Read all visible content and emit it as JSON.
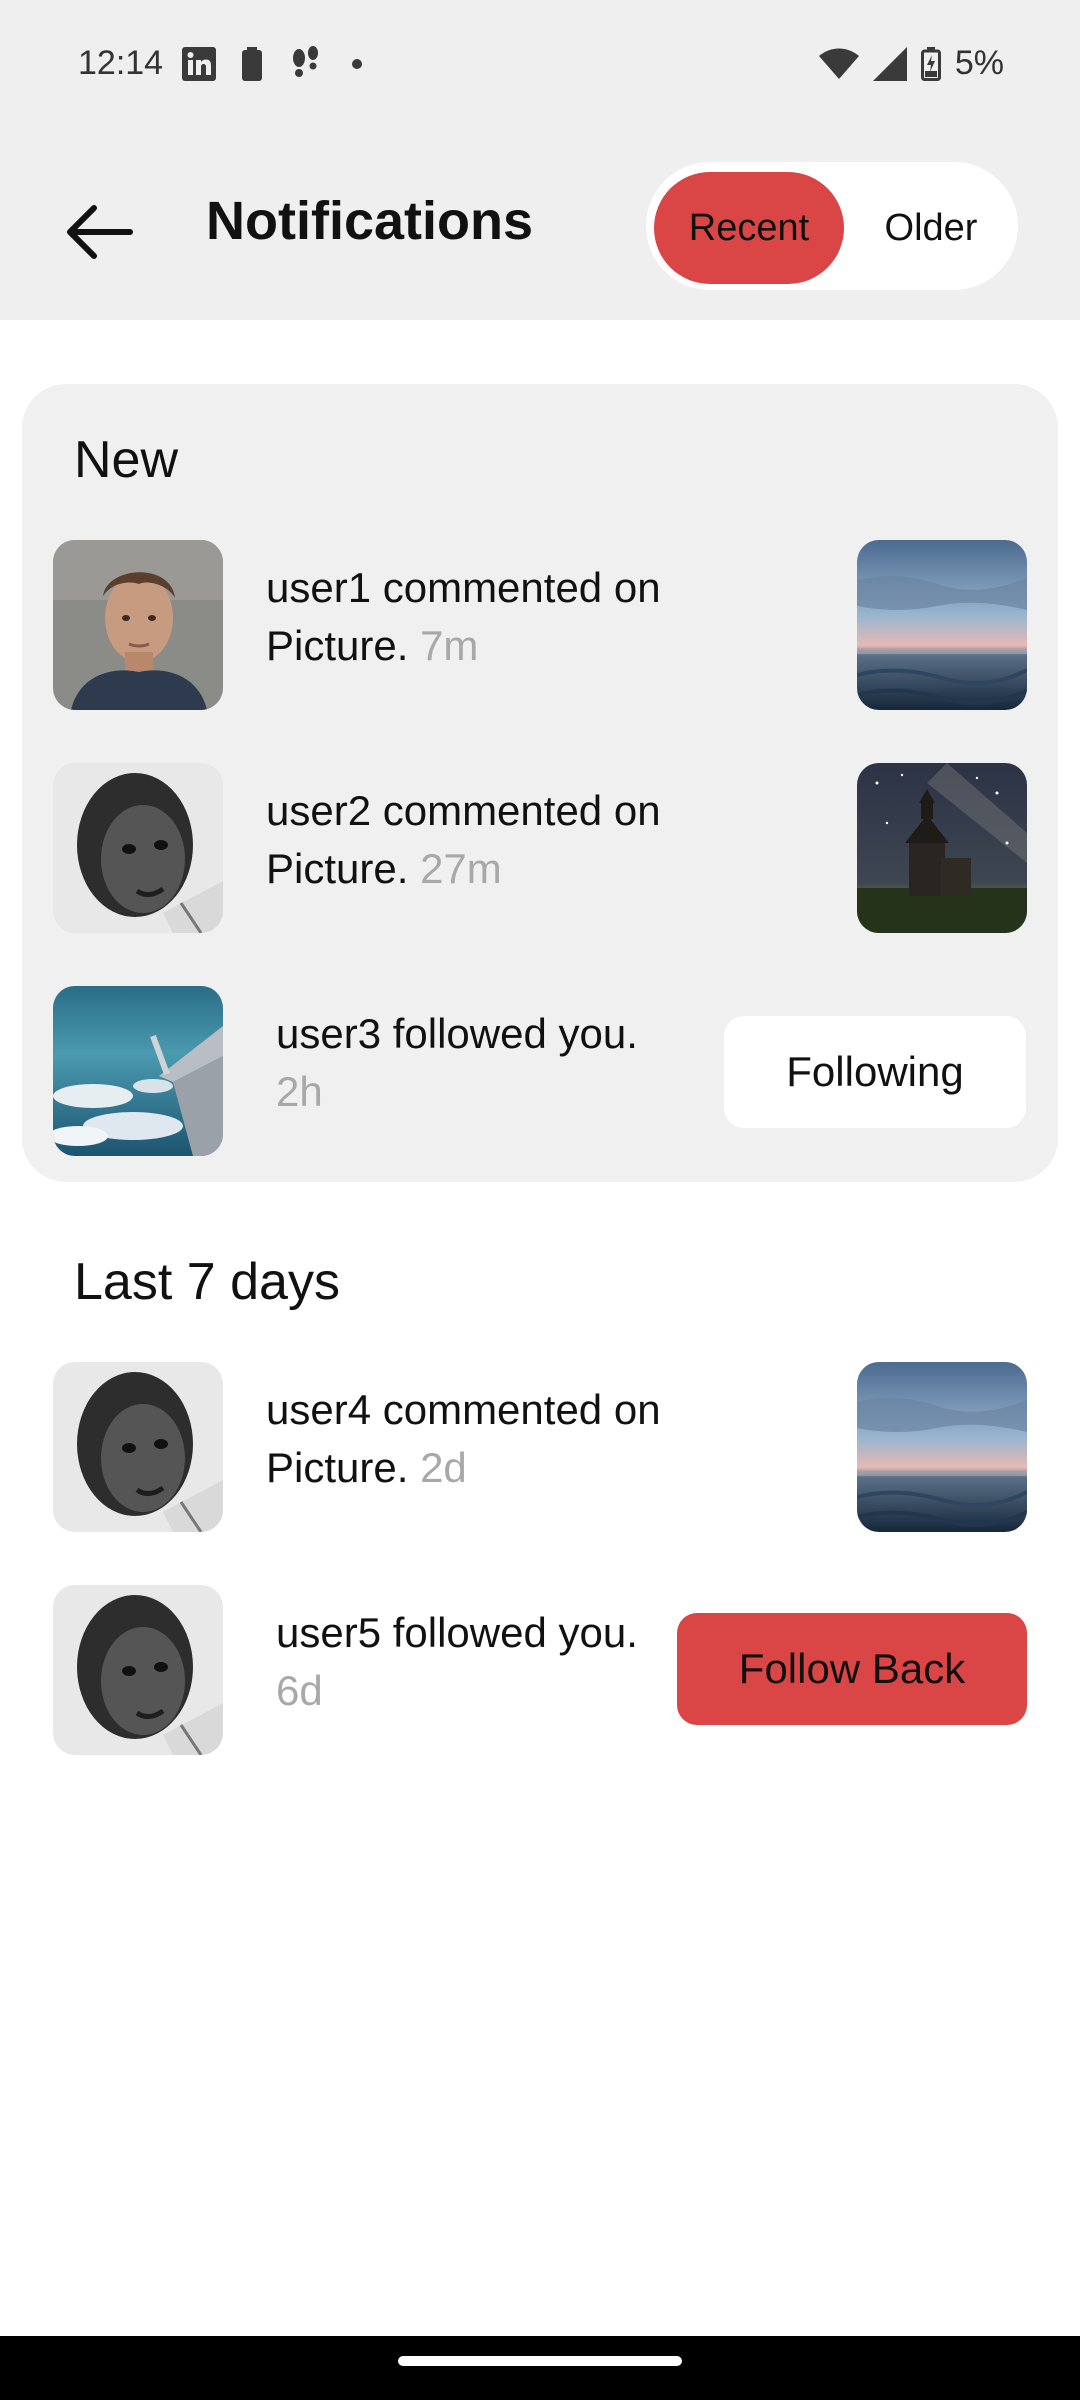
{
  "status_bar": {
    "time": "12:14",
    "battery": "5%",
    "left_icons": [
      "linkedin-icon",
      "battery-saver-icon",
      "footsteps-icon",
      "dot-icon"
    ],
    "right_icons": [
      "wifi-icon",
      "signal-icon",
      "battery-charging-icon"
    ]
  },
  "header": {
    "title": "Notifications",
    "tabs": [
      {
        "label": "Recent",
        "active": true
      },
      {
        "label": "Older",
        "active": false
      }
    ]
  },
  "sections": {
    "new": {
      "title": "New",
      "items": [
        {
          "user": "user1",
          "text": "user1 commented on Picture.",
          "time": "7m",
          "type": "comment"
        },
        {
          "user": "user2",
          "text": "user2 commented on Picture.",
          "time": "27m",
          "type": "comment"
        },
        {
          "user": "user3",
          "text": "user3 followed you.",
          "time": "2h",
          "type": "follow",
          "button": "Following"
        }
      ]
    },
    "last7": {
      "title": "Last 7 days",
      "items": [
        {
          "user": "user4",
          "text": "user4 commented on Picture.",
          "time": "2d",
          "type": "comment"
        },
        {
          "user": "user5",
          "text": "user5 followed you.",
          "time": "6d",
          "type": "follow",
          "button": "Follow Back"
        }
      ]
    }
  },
  "colors": {
    "accent": "#d94645",
    "header_bg": "#efefef",
    "card_bg": "#f0f0f0",
    "muted_text": "#a8a8a8"
  }
}
